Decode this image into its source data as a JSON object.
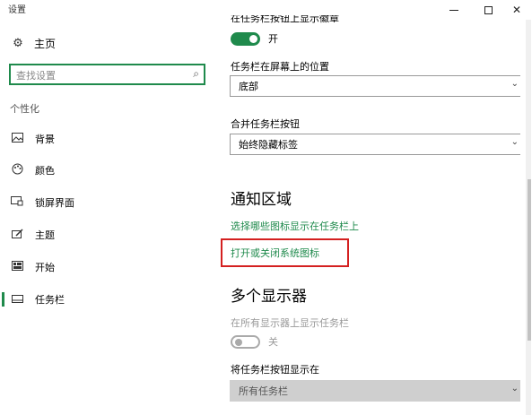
{
  "window": {
    "title": "设置",
    "controls": {
      "minimize_icon": "minimize-icon",
      "maximize_icon": "maximize-icon",
      "close_glyph": "✕"
    }
  },
  "sidebar": {
    "home": {
      "label": "主页",
      "icon": "gear-icon"
    },
    "search": {
      "placeholder": "查找设置",
      "icon": "search-icon"
    },
    "group_label": "个性化",
    "items": [
      {
        "label": "背景",
        "icon": "picture-icon",
        "glyph": "🖼",
        "active": false
      },
      {
        "label": "颜色",
        "icon": "palette-icon",
        "glyph": "🎨",
        "active": false
      },
      {
        "label": "锁屏界面",
        "icon": "lockscreen-icon",
        "glyph": "🖵",
        "active": false
      },
      {
        "label": "主题",
        "icon": "brush-icon",
        "glyph": "🖌",
        "active": false
      },
      {
        "label": "开始",
        "icon": "start-menu-icon",
        "glyph": "⊞",
        "active": false
      },
      {
        "label": "任务栏",
        "icon": "taskbar-icon",
        "glyph": "▭",
        "active": true
      }
    ]
  },
  "content": {
    "cut_off_heading": "在任务栏按钮上显示徽章",
    "badges_toggle": {
      "state_label": "开",
      "on": true
    },
    "taskbar_location": {
      "label": "任务栏在屏幕上的位置",
      "value": "底部"
    },
    "combine_buttons": {
      "label": "合并任务栏按钮",
      "value": "始终隐藏标签"
    },
    "notification_area": {
      "title": "通知区域",
      "link_select_icons": "选择哪些图标显示在任务栏上",
      "link_system_icons": "打开或关闭系统图标"
    },
    "multiple_displays": {
      "title": "多个显示器",
      "show_on_all_label": "在所有显示器上显示任务栏",
      "show_on_all_toggle": {
        "state_label": "关",
        "on": false
      },
      "show_buttons_label": "将任务栏按钮显示在",
      "show_buttons_value": "所有任务栏"
    }
  },
  "colors": {
    "accent": "#1f8a4c",
    "highlight_border": "#d42020"
  }
}
